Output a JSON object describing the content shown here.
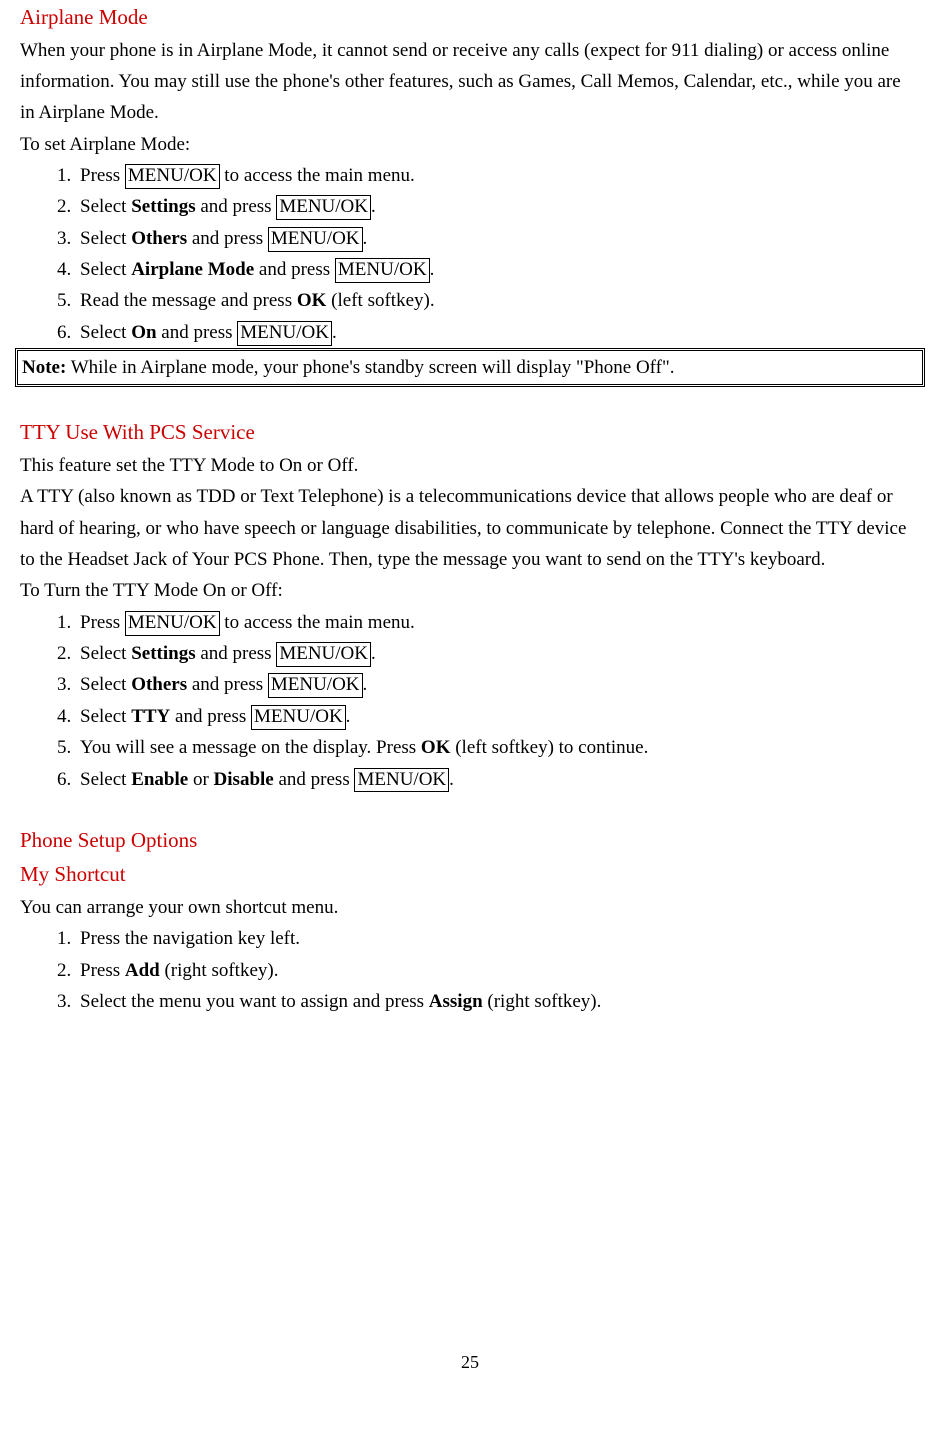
{
  "section1": {
    "heading": "Airplane Mode",
    "intro": "When your phone is in Airplane Mode, it cannot send or receive any calls (expect for 911 dialing) or access online information. You may still use the phone's other features, such as Games, Call Memos, Calendar, etc., while you are in Airplane Mode.",
    "lead": "To set Airplane Mode:",
    "step1_a": "Press ",
    "step1_key": "MENU/OK",
    "step1_b": " to access the main menu.",
    "step2_a": "Select ",
    "step2_bold": "Settings",
    "step2_b": " and press ",
    "step2_key": "MENU/OK",
    "step2_c": ".",
    "step3_a": "Select ",
    "step3_bold": "Others",
    "step3_b": " and press ",
    "step3_key": "MENU/OK",
    "step3_c": ".",
    "step4_a": "Select ",
    "step4_bold": "Airplane Mode",
    "step4_b": " and press ",
    "step4_key": "MENU/OK",
    "step4_c": ".",
    "step5_a": "Read the message and press ",
    "step5_bold": "OK",
    "step5_b": " (left softkey).",
    "step6_a": "Select ",
    "step6_bold": "On",
    "step6_b": " and press ",
    "step6_key": "MENU/OK",
    "step6_c": ".",
    "note_label": "Note:",
    "note_text": " While in Airplane mode, your phone's standby screen will display \"Phone Off\"."
  },
  "section2": {
    "heading": "TTY Use With PCS Service",
    "intro1": "This feature set the TTY Mode to On or Off.",
    "intro2": "A TTY (also known as TDD or Text Telephone) is a telecommunications device that allows people who are deaf or hard of hearing, or who have speech or language disabilities, to communicate by telephone. Connect the TTY device to the Headset Jack of Your PCS Phone. Then, type the message you want to send on the TTY's keyboard.",
    "lead": "To Turn the TTY Mode On or Off:",
    "step1_a": "Press ",
    "step1_key": "MENU/OK",
    "step1_b": " to access the main menu.",
    "step2_a": "Select ",
    "step2_bold": "Settings",
    "step2_b": " and press ",
    "step2_key": "MENU/OK",
    "step2_c": ".",
    "step3_a": "Select ",
    "step3_bold": "Others",
    "step3_b": " and press ",
    "step3_key": "MENU/OK",
    "step3_c": ".",
    "step4_a": "Select ",
    "step4_bold": "TTY",
    "step4_b": " and press ",
    "step4_key": "MENU/OK",
    "step4_c": ".",
    "step5_a": "You will see a message on the display. Press ",
    "step5_bold": "OK",
    "step5_b": " (left softkey) to continue.",
    "step6_a": "Select ",
    "step6_bold1": "Enable",
    "step6_b": " or ",
    "step6_bold2": "Disable",
    "step6_c": " and press ",
    "step6_key": "MENU/OK",
    "step6_d": "."
  },
  "section3": {
    "heading1": "Phone Setup Options",
    "heading2": "My Shortcut",
    "intro": "You can arrange your own shortcut menu.",
    "step1": "Press the navigation key left.",
    "step2_a": "Press ",
    "step2_bold": "Add",
    "step2_b": " (right softkey).",
    "step3_a": "Select the menu you want to assign and press ",
    "step3_bold": "Assign",
    "step3_b": " (right softkey)."
  },
  "page_number": "25"
}
